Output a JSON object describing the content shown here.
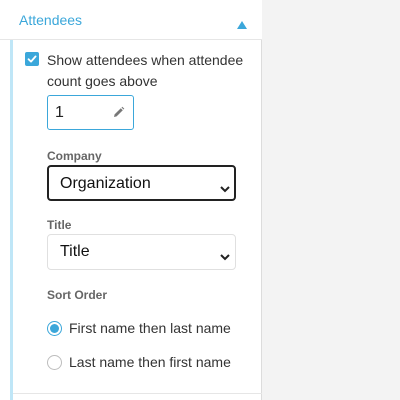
{
  "section": {
    "title": "Attendees",
    "collapse_icon": "chevron-up-icon"
  },
  "show_attendees": {
    "checked": true,
    "label": "Show attendees when attendee count goes above"
  },
  "count_input": {
    "value": "1",
    "icon": "pencil-icon"
  },
  "company": {
    "label": "Company",
    "selected": "Organization"
  },
  "title_field": {
    "label": "Title",
    "selected": "Title"
  },
  "sort_order": {
    "label": "Sort Order",
    "options": [
      {
        "label": "First name then last name",
        "selected": true
      },
      {
        "label": "Last name then first name",
        "selected": false
      }
    ]
  },
  "colors": {
    "accent": "#3ba7da",
    "text": "#333333",
    "muted_label": "#666666",
    "background": "#f3f3f3"
  }
}
